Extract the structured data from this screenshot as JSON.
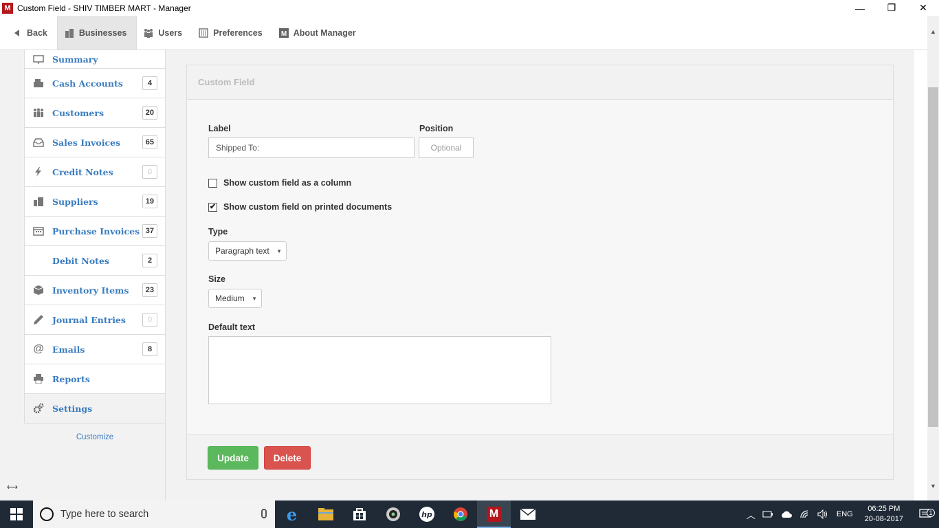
{
  "window": {
    "title": "Custom Field - SHIV TIMBER MART - Manager",
    "app_icon_letter": "M",
    "controls": {
      "minimize": "—",
      "restore": "❐",
      "close": "✕"
    }
  },
  "topnav": {
    "back": "Back",
    "businesses": "Businesses",
    "users": "Users",
    "preferences": "Preferences",
    "about": "About Manager"
  },
  "sidebar": {
    "items": [
      {
        "label": "Summary",
        "badge": ""
      },
      {
        "label": "Cash Accounts",
        "badge": "4"
      },
      {
        "label": "Customers",
        "badge": "20"
      },
      {
        "label": "Sales Invoices",
        "badge": "65"
      },
      {
        "label": "Credit Notes",
        "badge": "0"
      },
      {
        "label": "Suppliers",
        "badge": "19"
      },
      {
        "label": "Purchase Invoices",
        "badge": "37"
      },
      {
        "label": "Debit Notes",
        "badge": "2"
      },
      {
        "label": "Inventory Items",
        "badge": "23"
      },
      {
        "label": "Journal Entries",
        "badge": "0"
      },
      {
        "label": "Emails",
        "badge": "8"
      },
      {
        "label": "Reports",
        "badge": ""
      },
      {
        "label": "Settings",
        "badge": ""
      }
    ],
    "customize": "Customize",
    "collapse_icon": "collapse-arrows-icon"
  },
  "form": {
    "heading": "Custom Field",
    "label_label": "Label",
    "label_value": "Shipped To:",
    "position_label": "Position",
    "position_placeholder": "Optional",
    "show_column_label": "Show custom field as a column",
    "show_column_checked": false,
    "show_printed_label": "Show custom field on printed documents",
    "show_printed_checked": true,
    "type_label": "Type",
    "type_value": "Paragraph text",
    "size_label": "Size",
    "size_value": "Medium",
    "default_text_label": "Default text",
    "default_text_value": "",
    "update_button": "Update",
    "delete_button": "Delete"
  },
  "taskbar": {
    "search_placeholder": "Type here to search",
    "language": "ENG",
    "time": "06:25 PM",
    "date": "20-08-2017",
    "notification_count": "1"
  },
  "colors": {
    "link": "#3a7cbf",
    "update": "#5cb85c",
    "delete": "#d9534f",
    "taskbar": "#1f2a36",
    "app_red": "#b3161c"
  }
}
